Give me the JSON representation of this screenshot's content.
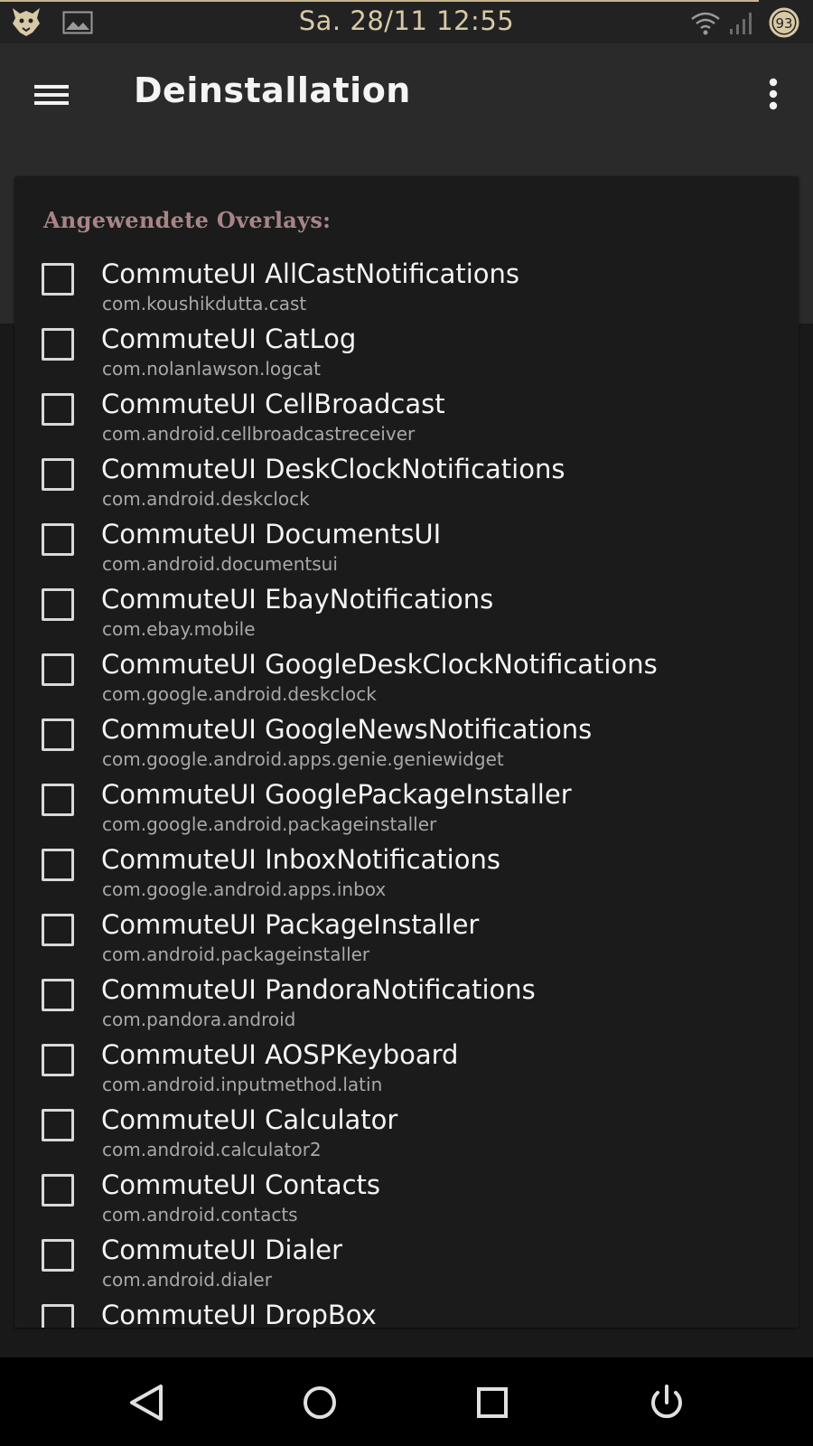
{
  "status_bar": {
    "datetime": "Sa. 28/11 12:55",
    "battery_level": "93",
    "icons": [
      "app-logo-icon",
      "image-notification-icon",
      "wifi-icon",
      "cell-signal-icon",
      "battery-icon"
    ],
    "accent_color": "#c9b58e"
  },
  "app_bar": {
    "title": "Deinstallation",
    "menu_icon": "hamburger-menu-icon",
    "overflow_icon": "more-vert-icon"
  },
  "section": {
    "title": "Angewendete Overlays:",
    "title_color": "#a88486"
  },
  "overlays": [
    {
      "name": "CommuteUI AllCastNotifications",
      "package": "com.koushikdutta.cast",
      "checked": false
    },
    {
      "name": "CommuteUI CatLog",
      "package": "com.nolanlawson.logcat",
      "checked": false
    },
    {
      "name": "CommuteUI CellBroadcast",
      "package": "com.android.cellbroadcastreceiver",
      "checked": false
    },
    {
      "name": "CommuteUI DeskClockNotifications",
      "package": "com.android.deskclock",
      "checked": false
    },
    {
      "name": "CommuteUI DocumentsUI",
      "package": "com.android.documentsui",
      "checked": false
    },
    {
      "name": "CommuteUI EbayNotifications",
      "package": "com.ebay.mobile",
      "checked": false
    },
    {
      "name": "CommuteUI GoogleDeskClockNotifications",
      "package": "com.google.android.deskclock",
      "checked": false
    },
    {
      "name": "CommuteUI GoogleNewsNotifications",
      "package": "com.google.android.apps.genie.geniewidget",
      "checked": false
    },
    {
      "name": "CommuteUI GooglePackageInstaller",
      "package": "com.google.android.packageinstaller",
      "checked": false
    },
    {
      "name": "CommuteUI InboxNotifications",
      "package": "com.google.android.apps.inbox",
      "checked": false
    },
    {
      "name": "CommuteUI PackageInstaller",
      "package": "com.android.packageinstaller",
      "checked": false
    },
    {
      "name": "CommuteUI PandoraNotifications",
      "package": "com.pandora.android",
      "checked": false
    },
    {
      "name": "CommuteUI AOSPKeyboard",
      "package": "com.android.inputmethod.latin",
      "checked": false
    },
    {
      "name": "CommuteUI Calculator",
      "package": "com.android.calculator2",
      "checked": false
    },
    {
      "name": "CommuteUI Contacts",
      "package": "com.android.contacts",
      "checked": false
    },
    {
      "name": "CommuteUI Dialer",
      "package": "com.android.dialer",
      "checked": false
    },
    {
      "name": "CommuteUI DropBox",
      "package": "",
      "checked": false
    }
  ],
  "nav_bar": {
    "buttons": [
      "back-icon",
      "home-icon",
      "recents-icon",
      "power-icon"
    ]
  }
}
